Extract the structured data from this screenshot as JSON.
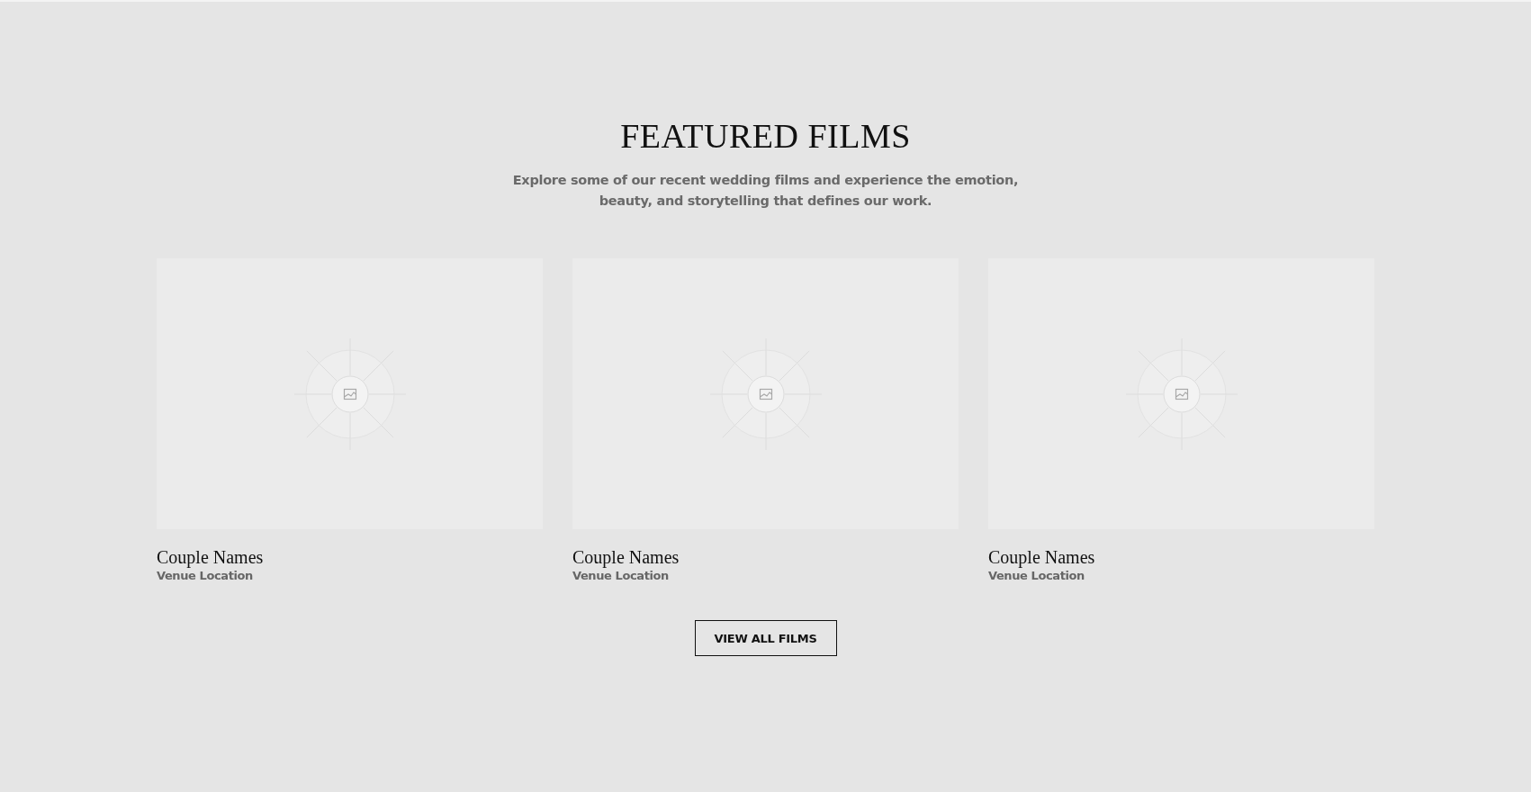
{
  "section": {
    "title": "FEATURED FILMS",
    "subtitle": "Explore some of our recent wedding films and experience the emotion, beauty, and storytelling that defines our work."
  },
  "films": [
    {
      "couple": "Couple Names",
      "venue": "Venue Location"
    },
    {
      "couple": "Couple Names",
      "venue": "Venue Location"
    },
    {
      "couple": "Couple Names",
      "venue": "Venue Location"
    }
  ],
  "button": "VIEW ALL FILMS"
}
